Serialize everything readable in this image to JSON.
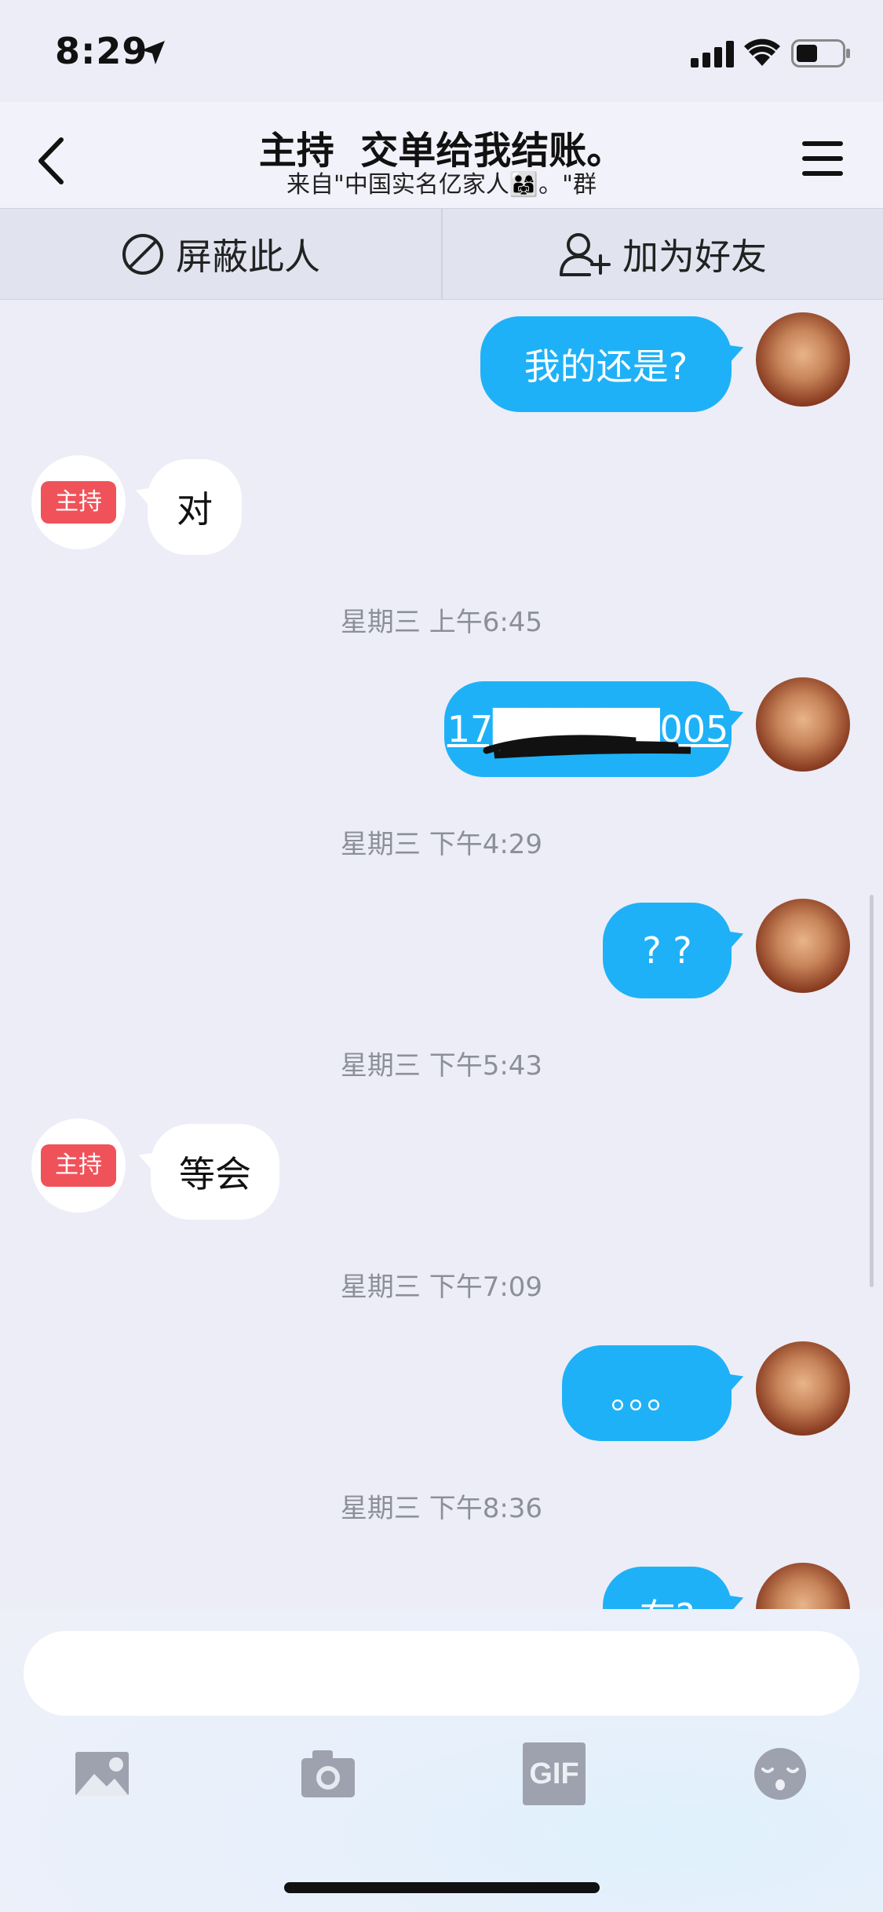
{
  "status": {
    "time": "8:29"
  },
  "nav": {
    "title": "主持  交单给我结账。",
    "subtitle": "来自\"中国实名亿家人👨‍👩‍👧。\"群"
  },
  "actions": {
    "block_label": "屏蔽此人",
    "add_label": "加为好友"
  },
  "host_badge": "主持",
  "messages": {
    "m1": "我的还是?",
    "m2": "对",
    "t1": "星期三 上午6:45",
    "m3": "17██████005",
    "t2": "星期三 下午4:29",
    "m4": "? ?",
    "t3": "星期三 下午5:43",
    "m5": "等会",
    "t4": "星期三 下午7:09",
    "m6": "。。。",
    "t5": "星期三 下午8:36",
    "m7": "在?"
  },
  "colors": {
    "outgoing_bubble": "#1fb1f7",
    "host_badge": "#f0525a"
  },
  "toolbar": {
    "icons": [
      "image-icon",
      "camera-icon",
      "gif-icon",
      "emoji-icon"
    ],
    "gif_label": "GIF"
  }
}
